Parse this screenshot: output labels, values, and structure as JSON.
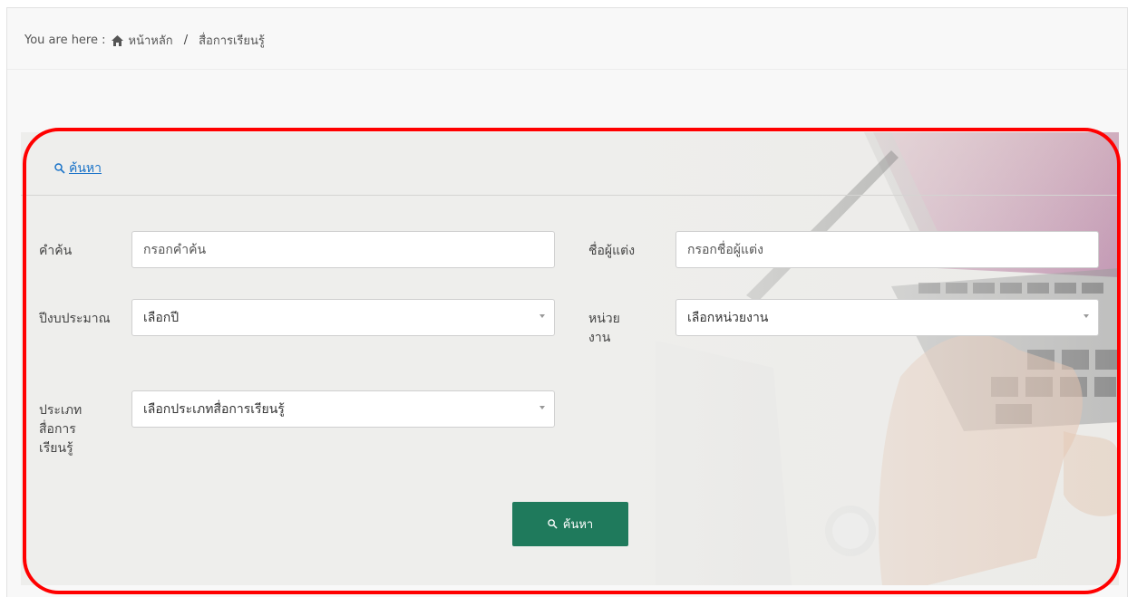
{
  "breadcrumb": {
    "prefix": "You are here :",
    "home": "หน้าหลัก",
    "separator": "/",
    "current": "สื่อการเรียนรู้"
  },
  "search_panel": {
    "toggle_label": "ค้นหา",
    "keyword": {
      "label": "คำค้น",
      "placeholder": "กรอกคำค้น",
      "value": ""
    },
    "author": {
      "label": "ชื่อผู้แต่ง",
      "placeholder": "กรอกชื่อผู้แต่ง",
      "value": ""
    },
    "budget_year": {
      "label": "ปีงบประมาณ",
      "selected": "เลือกปี"
    },
    "agency": {
      "label_line1": "หน่วย",
      "label_line2": "งาน",
      "selected": "เลือกหน่วยงาน"
    },
    "media_type": {
      "label_line1": "ประเภท",
      "label_line2": "สื่อการ",
      "label_line3": "เรียนรู้",
      "selected": "เลือกประเภทสื่อการเรียนรู้"
    },
    "submit_label": "ค้นหา"
  },
  "colors": {
    "accent_button": "#1f7a5c",
    "link": "#1a73c8",
    "annotation_highlight": "#ff0000"
  },
  "icons": [
    "home-icon",
    "search-icon",
    "chevron-down-icon"
  ]
}
